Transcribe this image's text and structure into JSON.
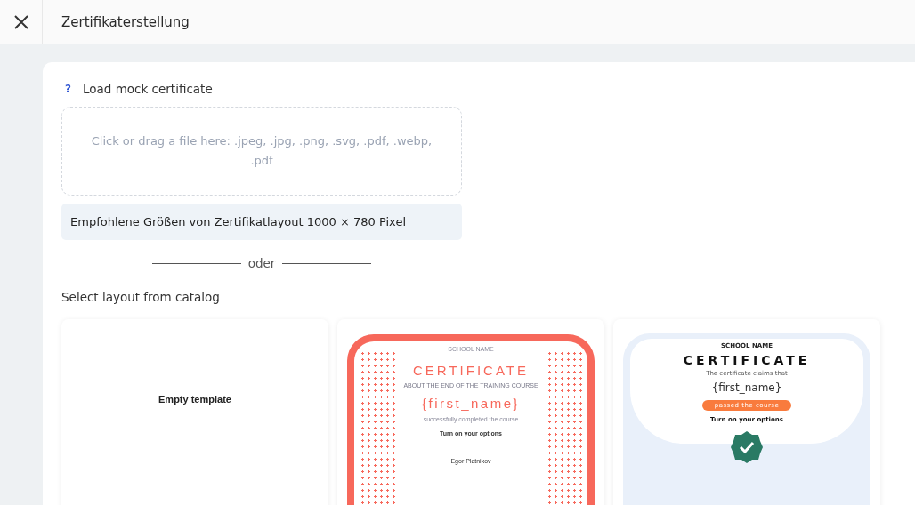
{
  "header": {
    "title": "Zertifikaterstellung"
  },
  "upload": {
    "label": "Load mock certificate",
    "help": "?",
    "dropzone": "Click or drag a file here: .jpeg, .jpg, .png, .svg, .pdf, .webp, .pdf",
    "hint": "Empfohlene Größen von Zertifikatlayout 1000 × 780 Pixel"
  },
  "divider": "oder",
  "catalog": {
    "label": "Select layout from catalog",
    "templates": [
      {
        "kind": "empty",
        "label": "Empty template"
      },
      {
        "kind": "dotted",
        "school": "SCHOOL NAME",
        "title": "CERTIFICATE",
        "subtitle": "ABOUT THE END OF THE TRAINING COURSE",
        "name": "{first_name}",
        "line": "successfully completed the course",
        "options": "Turn on your options",
        "signature": "Egor Platnikov"
      },
      {
        "kind": "wave",
        "school": "SCHOOL NAME",
        "title": "CERTIFICATE",
        "subtitle": "The certificate claims that",
        "name": "{first_name}",
        "pill": "passed the course",
        "options": "Turn on your options"
      }
    ]
  }
}
